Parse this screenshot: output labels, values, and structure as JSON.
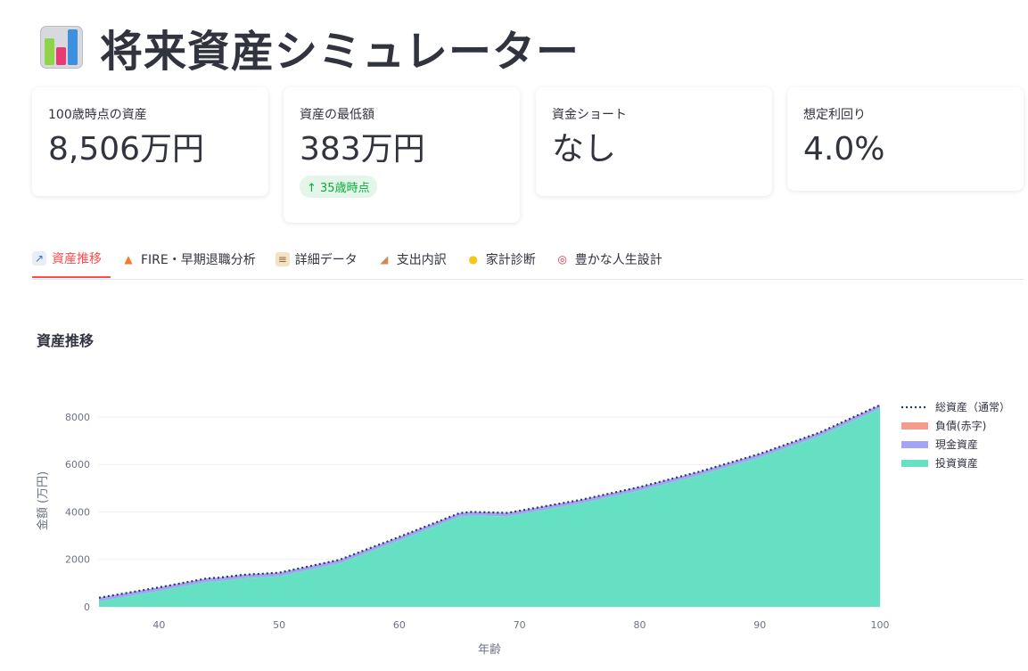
{
  "app": {
    "title": "将来資産シミュレーター",
    "title_icon": "bar-chart-icon"
  },
  "metrics": [
    {
      "label": "100歳時点の資産",
      "value": "8,506万円"
    },
    {
      "label": "資産の最低額",
      "value": "383万円",
      "delta": "↑ 35歳時点",
      "delta_color": "#09ab3b"
    },
    {
      "label": "資金ショート",
      "value": "なし"
    },
    {
      "label": "想定利回り",
      "value": "4.0%"
    }
  ],
  "tabs": [
    {
      "label": "資産推移",
      "icon": "chart-icon",
      "active": true
    },
    {
      "label": "FIRE・早期退職分析",
      "icon": "fire-icon",
      "active": false
    },
    {
      "label": "詳細データ",
      "icon": "clipboard-icon",
      "active": false
    },
    {
      "label": "支出内訳",
      "icon": "cake-icon",
      "active": false
    },
    {
      "label": "家計診断",
      "icon": "lightbulb-icon",
      "active": false
    },
    {
      "label": "豊かな人生設計",
      "icon": "target-icon",
      "active": false
    }
  ],
  "section": {
    "title": "資産推移"
  },
  "colors": {
    "accent": "#ff4b4b",
    "investment": "#66e0c2",
    "cash": "#a3a4f5",
    "debt": "#f59b8c",
    "total": "#2a3a5a"
  },
  "chart_data": {
    "type": "area",
    "xlabel": "年齢",
    "ylabel": "金額 (万円)",
    "xlim": [
      35,
      100
    ],
    "ylim": [
      0,
      8600
    ],
    "x_ticks": [
      40,
      50,
      60,
      70,
      80,
      90,
      100
    ],
    "y_ticks": [
      0,
      2000,
      4000,
      6000,
      8000
    ],
    "grid": true,
    "legend_position": "right",
    "x": [
      35,
      40,
      44,
      45,
      47,
      50,
      55,
      60,
      65,
      66,
      69,
      70,
      75,
      80,
      85,
      90,
      95,
      100
    ],
    "series": [
      {
        "name": "総資産（通常）",
        "style": "dotted-line",
        "values": [
          383,
          820,
          1200,
          1230,
          1350,
          1440,
          1980,
          2950,
          3950,
          4000,
          3960,
          4050,
          4500,
          5050,
          5700,
          6450,
          7350,
          8506
        ]
      },
      {
        "name": "負債(赤字)",
        "style": "area",
        "values": [
          0,
          0,
          0,
          0,
          0,
          0,
          0,
          0,
          0,
          0,
          0,
          0,
          0,
          0,
          0,
          0,
          0,
          0
        ]
      },
      {
        "name": "現金資産",
        "style": "stacked-area",
        "values": [
          150,
          150,
          150,
          150,
          150,
          150,
          150,
          150,
          150,
          150,
          150,
          150,
          150,
          150,
          150,
          150,
          150,
          150
        ]
      },
      {
        "name": "投資資産",
        "style": "stacked-area",
        "values": [
          233,
          670,
          1050,
          1080,
          1200,
          1290,
          1830,
          2800,
          3800,
          3850,
          3810,
          3900,
          4350,
          4900,
          5550,
          6300,
          7200,
          8356
        ]
      }
    ]
  }
}
